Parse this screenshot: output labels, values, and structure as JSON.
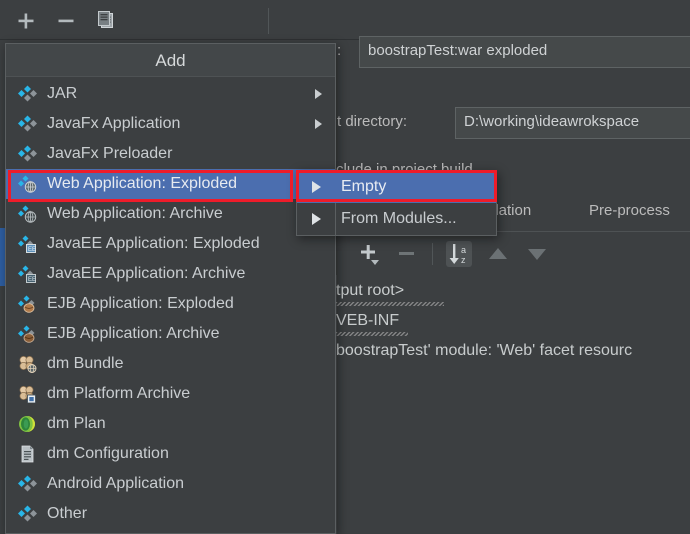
{
  "toolbar": {
    "add_icon": "plus-icon",
    "remove_icon": "minus-icon",
    "copy_icon": "copy-icon"
  },
  "background": {
    "name_label": ":",
    "name_value": "boostrapTest:war exploded",
    "output_directory_label": "t directory:",
    "output_directory_value": "D:\\working\\ideawrokspace",
    "include_in_build_label": "clude in project build",
    "tabs": [
      {
        "label": "idation"
      },
      {
        "label": "Pre-process"
      }
    ],
    "tree_toolbar": {
      "add_icon": "plus-dropdown-icon",
      "remove_icon": "minus-icon",
      "sort_icon": "sort-az-icon",
      "up_icon": "arrow-up-icon",
      "down_icon": "arrow-down-icon"
    },
    "tree_rows": [
      "tput root>",
      "VEB-INF",
      "boostrapTest' module: 'Web' facet resourc"
    ]
  },
  "menu": {
    "title": "Add",
    "items": [
      {
        "label": "JAR",
        "icon": "artifact-diamonds-icon",
        "submenu": true,
        "selected": false
      },
      {
        "label": "JavaFx Application",
        "icon": "artifact-diamonds-icon",
        "submenu": true,
        "selected": false
      },
      {
        "label": "JavaFx Preloader",
        "icon": "artifact-diamonds-icon",
        "submenu": false,
        "selected": false
      },
      {
        "label": "Web Application: Exploded",
        "icon": "web-exploded-icon",
        "submenu": true,
        "selected": true
      },
      {
        "label": "Web Application: Archive",
        "icon": "web-archive-icon",
        "submenu": true,
        "selected": false
      },
      {
        "label": "JavaEE Application: Exploded",
        "icon": "javaee-exploded-icon",
        "submenu": false,
        "selected": false
      },
      {
        "label": "JavaEE Application: Archive",
        "icon": "javaee-archive-icon",
        "submenu": false,
        "selected": false
      },
      {
        "label": "EJB Application: Exploded",
        "icon": "ejb-exploded-icon",
        "submenu": false,
        "selected": false
      },
      {
        "label": "EJB Application: Archive",
        "icon": "ejb-archive-icon",
        "submenu": false,
        "selected": false
      },
      {
        "label": "dm Bundle",
        "icon": "dm-bundle-icon",
        "submenu": false,
        "selected": false
      },
      {
        "label": "dm Platform Archive",
        "icon": "dm-platform-archive-icon",
        "submenu": false,
        "selected": false
      },
      {
        "label": "dm Plan",
        "icon": "dm-plan-icon",
        "submenu": false,
        "selected": false
      },
      {
        "label": "dm Configuration",
        "icon": "dm-configuration-icon",
        "submenu": false,
        "selected": false
      },
      {
        "label": "Android Application",
        "icon": "artifact-diamonds-icon",
        "submenu": false,
        "selected": false
      },
      {
        "label": "Other",
        "icon": "artifact-diamonds-icon",
        "submenu": false,
        "selected": false
      }
    ]
  },
  "submenu": {
    "items": [
      {
        "label": "Empty",
        "selected": true,
        "arrow": true
      },
      {
        "label": "From Modules...",
        "selected": false,
        "arrow": true
      }
    ]
  },
  "colors": {
    "selection_blue": "#4b6eaf",
    "annotation_red": "#ee1c2a",
    "panel_bg": "#3c3f41",
    "field_bg": "#45494a",
    "text": "#c9cdd0"
  }
}
